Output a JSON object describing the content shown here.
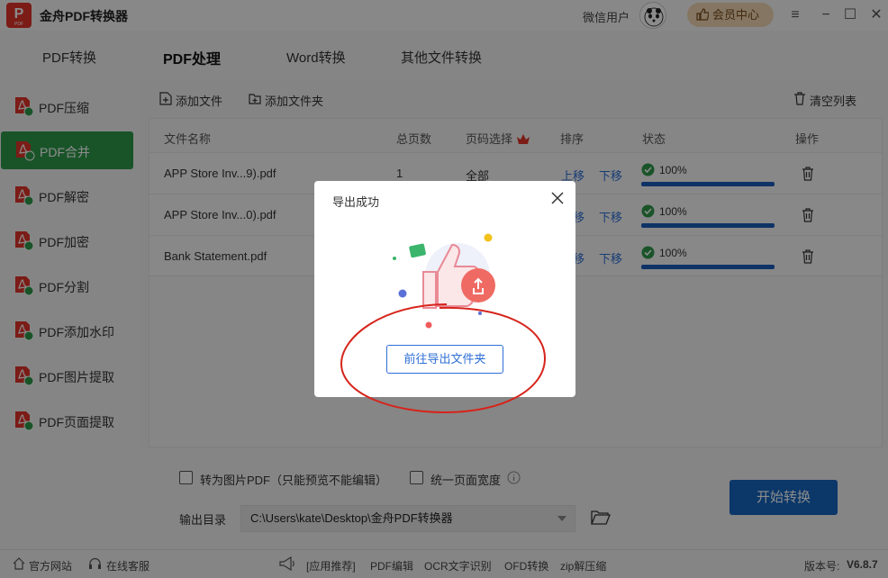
{
  "app": {
    "logo_text": "P",
    "logo_sub": "PDF",
    "title": "金舟PDF转换器"
  },
  "header": {
    "user_name": "微信用户",
    "vip_label": "会员中心"
  },
  "nav": {
    "tabs": [
      "PDF转换",
      "PDF处理",
      "Word转换",
      "其他文件转换"
    ],
    "active": "PDF处理"
  },
  "sidebar": {
    "items": [
      "PDF压缩",
      "PDF合并",
      "PDF解密",
      "PDF加密",
      "PDF分割",
      "PDF添加水印",
      "PDF图片提取",
      "PDF页面提取"
    ],
    "active": "PDF合并"
  },
  "toolbar": {
    "add_file": "添加文件",
    "add_folder": "添加文件夹",
    "clear_list": "清空列表"
  },
  "table": {
    "headers": {
      "name": "文件名称",
      "pages": "总页数",
      "page_select": "页码选择",
      "order": "排序",
      "status": "状态",
      "action": "操作"
    },
    "rows": [
      {
        "name": "APP Store Inv...9).pdf",
        "pages": "1",
        "range": "全部",
        "up": "上移",
        "down": "下移",
        "progress": 1.0,
        "percent": "100%"
      },
      {
        "name": "APP Store Inv...0).pdf",
        "pages": "",
        "range": "",
        "up": "上移",
        "down": "下移",
        "progress": 1.0,
        "percent": "100%"
      },
      {
        "name": "Bank Statement.pdf",
        "pages": "",
        "range": "",
        "up": "上移",
        "down": "下移",
        "progress": 1.0,
        "percent": "100%"
      }
    ]
  },
  "options": {
    "to_image": "转为图片PDF（只能预览不能编辑）",
    "uniform_width": "统一页面宽度",
    "output_label": "输出目录",
    "output_path": "C:\\Users\\kate\\Desktop\\金舟PDF转换器"
  },
  "start_button": "开始转换",
  "statusbar": {
    "website": "官方网站",
    "service": "在线客服",
    "recommend": "[应用推荐]",
    "links": [
      "PDF编辑",
      "OCR文字识别",
      "OFD转换",
      "zip解压缩"
    ],
    "version_label": "版本号:",
    "version": "V6.8.7"
  },
  "dialog": {
    "title": "导出成功",
    "button": "前往导出文件夹"
  },
  "colors": {
    "accent_green": "#2f9a4b",
    "primary_blue": "#1565c0",
    "link_blue": "#2d6fd6",
    "annotation_red": "#d6241b"
  }
}
